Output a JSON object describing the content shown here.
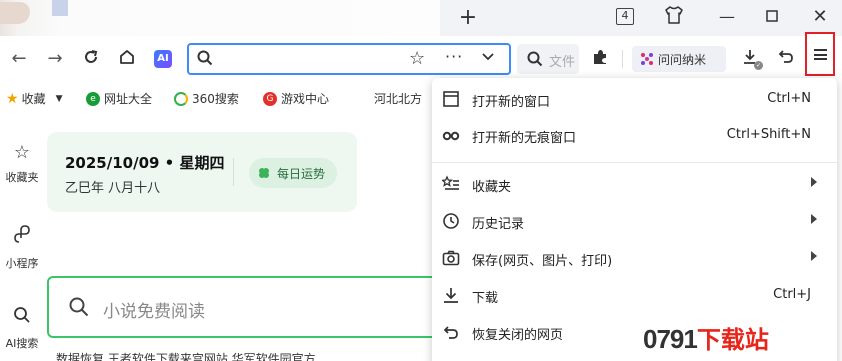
{
  "tabbar": {
    "new_tab_label": "+",
    "tab_count": "4",
    "window_controls": {
      "minimize": "—",
      "maximize": "☐",
      "close": "✕"
    }
  },
  "toolbar": {
    "ai_label": "AI",
    "search_placeholder": "文件",
    "ask_label": "问问纳米"
  },
  "bookmarks": {
    "items": [
      {
        "label": "收藏",
        "icon": "star-icon"
      },
      {
        "label": "网址大全",
        "icon": "globe-icon"
      },
      {
        "label": "360搜索",
        "icon": "search360-icon"
      },
      {
        "label": "游戏中心",
        "icon": "game-icon"
      },
      {
        "label": "河北北方",
        "icon": ""
      }
    ]
  },
  "rail": {
    "items": [
      {
        "label": "收藏夹",
        "icon": "star-icon"
      },
      {
        "label": "小程序",
        "icon": "miniapp-icon"
      },
      {
        "label": "AI搜索",
        "icon": "search-icon"
      }
    ]
  },
  "content": {
    "date": "2025/10/09 • 星期四",
    "lunar": "乙巳年 八月十八",
    "fortune": "每日运势",
    "search_placeholder": "小说免费阅读",
    "news": "数据恢复    王者软件下载来宫网站    华军软件园官方"
  },
  "menu": {
    "items": [
      {
        "label": "打开新的窗口",
        "shortcut": "Ctrl+N",
        "submenu": false,
        "icon": "window-icon"
      },
      {
        "label": "打开新的无痕窗口",
        "shortcut": "Ctrl+Shift+N",
        "submenu": false,
        "icon": "incognito-icon"
      },
      {
        "label": "收藏夹",
        "shortcut": "",
        "submenu": true,
        "icon": "favorites-list-icon"
      },
      {
        "label": "历史记录",
        "shortcut": "",
        "submenu": true,
        "icon": "history-icon"
      },
      {
        "label": "保存(网页、图片、打印)",
        "shortcut": "",
        "submenu": true,
        "icon": "camera-icon"
      },
      {
        "label": "下载",
        "shortcut": "Ctrl+J",
        "submenu": false,
        "icon": "download-icon"
      },
      {
        "label": "恢复关闭的网页",
        "shortcut": "",
        "submenu": false,
        "icon": "restore-icon"
      }
    ]
  },
  "watermark": {
    "number": "0791",
    "text": "下载站"
  },
  "colors": {
    "accent": "#3d8bff",
    "highlight": "#e2202a",
    "green": "#3cc46a"
  }
}
